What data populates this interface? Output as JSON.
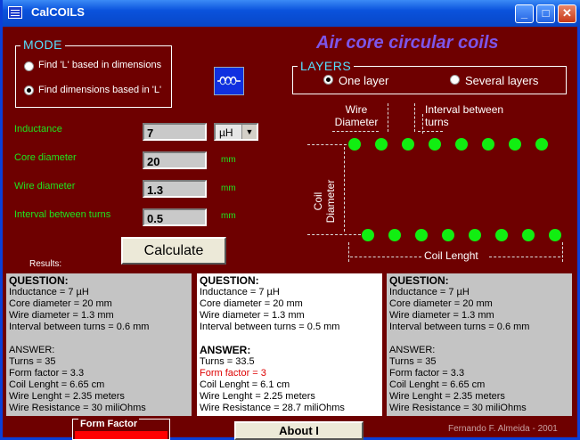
{
  "window": {
    "title": "CalCOILS"
  },
  "heading": "Air core circular coils",
  "mode": {
    "legend": "MODE",
    "options": [
      "Find 'L' based in dimensions",
      "Find dimensions based in 'L'"
    ],
    "selected": 1
  },
  "layers": {
    "legend": "LAYERS",
    "options": [
      "One layer",
      "Several layers"
    ],
    "selected": 0
  },
  "inputs": {
    "inductance": {
      "label": "Inductance",
      "value": "7",
      "unit": "µH"
    },
    "core_diameter": {
      "label": "Core diameter",
      "value": "20",
      "unit": "mm"
    },
    "wire_diameter": {
      "label": "Wire diameter",
      "value": "1.3",
      "unit": "mm"
    },
    "interval": {
      "label": "Interval between turns",
      "value": "0.5",
      "unit": "mm"
    }
  },
  "calculate_label": "Calculate",
  "results_label": "Results:",
  "diagram": {
    "wire_diameter": [
      "Wire",
      "Diameter"
    ],
    "interval": [
      "Interval between",
      "turns"
    ],
    "coil_diameter": [
      "Coil",
      "Diameter"
    ],
    "coil_length": "Coil Lenght"
  },
  "panels": [
    {
      "question": "QUESTION:",
      "q": [
        "Inductance = 7 µH",
        "Core diameter = 20 mm",
        "Wire diameter = 1.3 mm",
        "Interval between turns = 0.6 mm"
      ],
      "answer": "ANSWER:",
      "a": [
        "Turns = 35",
        "Form factor = 3.3",
        "Coil Lenght = 6.65 cm",
        "Wire Lenght = 2.35 meters",
        "Wire Resistance = 30 miliOhms"
      ]
    },
    {
      "question": "QUESTION:",
      "q": [
        "Inductance = 7 µH",
        "Core diameter = 20 mm",
        "Wire diameter = 1.3 mm",
        "Interval between turns = 0.5 mm"
      ],
      "answer": "ANSWER:",
      "a": [
        "Turns = 33.5",
        "Form factor = 3",
        "Coil Lenght = 6.1 cm",
        "Wire Lenght = 2.25 meters",
        "Wire Resistance = 28.7 miliOhms"
      ]
    },
    {
      "question": "QUESTION:",
      "q": [
        "Inductance = 7 µH",
        "Core diameter = 20 mm",
        "Wire diameter = 1.3 mm",
        "Interval between turns = 0.6 mm"
      ],
      "answer": "ANSWER:",
      "a": [
        "Turns = 35",
        "Form factor = 3.3",
        "Coil Lenght = 6.65 cm",
        "Wire Lenght = 2.35 meters",
        "Wire Resistance = 30 miliOhms"
      ]
    }
  ],
  "form_factor_label": "Form Factor",
  "about_label": "About I",
  "credit": "Fernando F. Almeida - 2001",
  "colors": {
    "background": "#6e0000",
    "labels": "#1ee61e",
    "legend": "#55e0ff",
    "heading": "#7d55e8",
    "dots": "#11ee11"
  }
}
